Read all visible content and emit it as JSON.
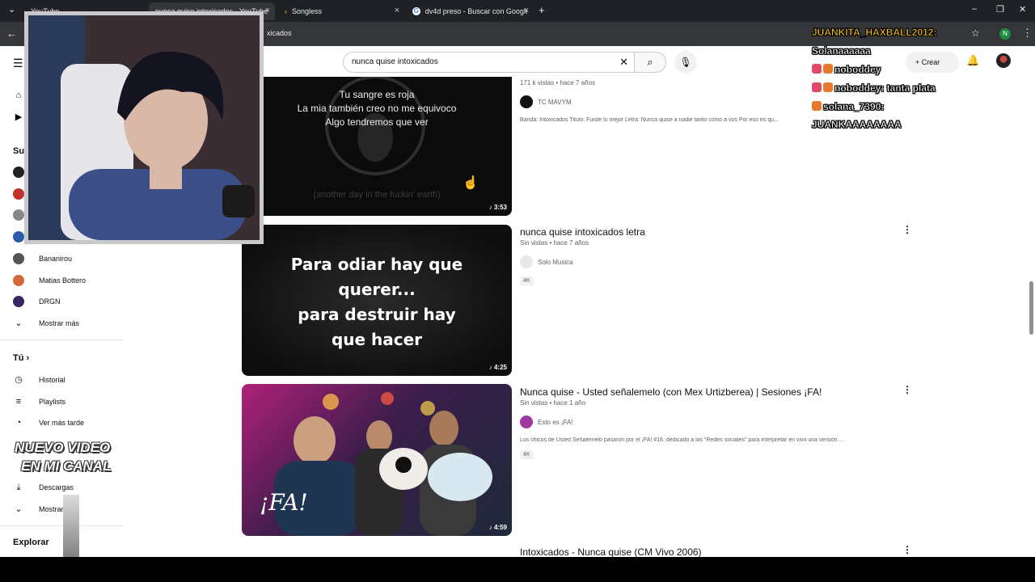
{
  "browser": {
    "tabs": [
      {
        "title": "YouTube",
        "active": false
      },
      {
        "title": "nunca quise intoxicados - YouTube",
        "active": true
      },
      {
        "title": "Songless",
        "active": false
      },
      {
        "title": "dv4d preso - Buscar con Google",
        "active": false
      }
    ],
    "url_fragment": "xicados",
    "profile_initial": "N"
  },
  "search": {
    "query": "nunca quise intoxicados"
  },
  "header": {
    "create_label": "Crear"
  },
  "sidebar": {
    "subs_header": "Su",
    "channels": [
      {
        "name": "Bananirou",
        "color": "#555"
      },
      {
        "name": "Matias Bottero",
        "color": "#d2693b"
      },
      {
        "name": "DRGN",
        "color": "#3a2560"
      }
    ],
    "show_more": "Mostrar más",
    "you_header": "Tú",
    "you_items": [
      {
        "label": "Historial",
        "icon": "history-icon"
      },
      {
        "label": "Playlists",
        "icon": "playlists-icon"
      },
      {
        "label": "Ver más tarde",
        "icon": "watch-later-icon"
      },
      {
        "label": "Descargas",
        "icon": "download-icon"
      },
      {
        "label": "Mostrar más",
        "icon": "chevron-down-icon"
      }
    ],
    "explore_header": "Explorar"
  },
  "results": [
    {
      "meta": "171 k vistas • hace 7 años",
      "channel": "TC MAVYM",
      "description": "Banda: Intoxicados Titulo: Fuiste lo mejor Letra: Nunca quise a nadie tanto como a vos Por eso es qu...",
      "duration": "3:53",
      "thumb_lines": [
        "Tu sangre es roja",
        "La mia también creo no me equivoco",
        "Algo tendremos que ver"
      ],
      "thumb_caption": "(another day in the fuckin' earth)"
    },
    {
      "title": "nunca quise intoxicados letra",
      "meta": "Sin vistas • hace 7 años",
      "channel": "Solo Musica",
      "badge": "4K",
      "duration": "4:25",
      "thumb_lines": [
        "Para odiar hay que",
        "querer...",
        "para destruir hay",
        "que hacer"
      ]
    },
    {
      "title": "Nunca quise - Usted señalemelo (con Mex Urtizberea) | Sesiones ¡FA!",
      "meta": "Sin vistas • hace 1 año",
      "channel": "Esto es ¡FA!",
      "description": "Los chicos de Usted Señalemelo pasaron por el ¡FA! #16, dedicado a las \"Redes sociales\" para interpretar en vivo una versión ...",
      "badge": "4K",
      "duration": "4:59",
      "thumb_text": "¡FA!"
    },
    {
      "title": "Intoxicados - Nunca quise (CM Vivo 2006)"
    }
  ],
  "chat": [
    {
      "user": "JUANKITA_HAXBALL2012:",
      "text": ""
    },
    {
      "user": "",
      "text": "Solanaaaaaa"
    },
    {
      "user": "noboddey",
      "text": ""
    },
    {
      "user": "noboddey:",
      "text": "tanta plata"
    },
    {
      "user": "solana_7390:",
      "text": ""
    },
    {
      "user": "",
      "text": "JUANKAAAAAAAA"
    }
  ],
  "promo": {
    "line1": "NUEVO VIDEO",
    "line2": "EN MI CANAL"
  }
}
